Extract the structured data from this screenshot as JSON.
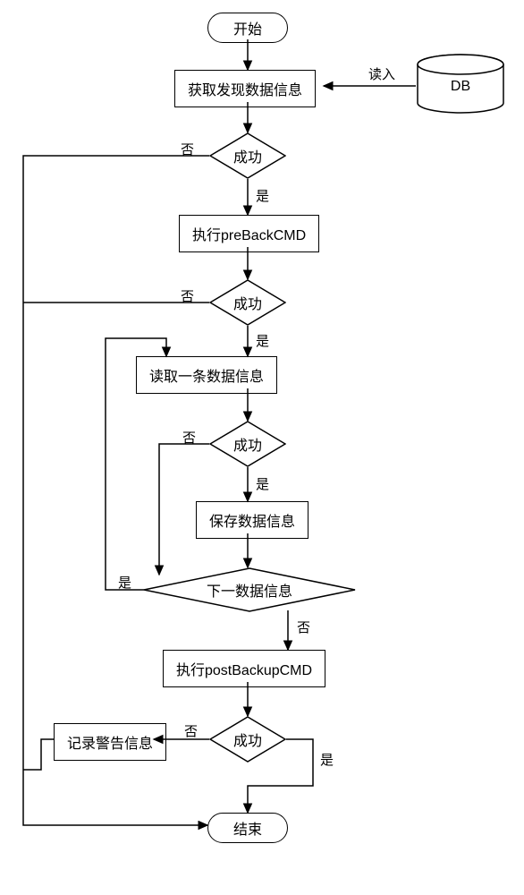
{
  "chart_data": {
    "type": "flowchart",
    "title": "",
    "nodes": [
      {
        "id": "start",
        "type": "terminal",
        "label": "开始"
      },
      {
        "id": "fetch",
        "type": "process",
        "label": "获取发现数据信息"
      },
      {
        "id": "db",
        "type": "database",
        "label": "DB"
      },
      {
        "id": "succ1",
        "type": "decision",
        "label": "成功"
      },
      {
        "id": "preback",
        "type": "process",
        "label": "执行preBackCMD"
      },
      {
        "id": "succ2",
        "type": "decision",
        "label": "成功"
      },
      {
        "id": "readone",
        "type": "process",
        "label": "读取一条数据信息"
      },
      {
        "id": "succ3",
        "type": "decision",
        "label": "成功"
      },
      {
        "id": "save",
        "type": "process",
        "label": "保存数据信息"
      },
      {
        "id": "next",
        "type": "decision",
        "label": "下一数据信息"
      },
      {
        "id": "postback",
        "type": "process",
        "label": "执行postBackupCMD"
      },
      {
        "id": "succ4",
        "type": "decision",
        "label": "成功"
      },
      {
        "id": "warn",
        "type": "process",
        "label": "记录警告信息"
      },
      {
        "id": "end",
        "type": "terminal",
        "label": "结束"
      }
    ],
    "edges": [
      {
        "from": "start",
        "to": "fetch",
        "label": ""
      },
      {
        "from": "db",
        "to": "fetch",
        "label": "读入"
      },
      {
        "from": "fetch",
        "to": "succ1",
        "label": ""
      },
      {
        "from": "succ1",
        "to": "preback",
        "label": "是"
      },
      {
        "from": "succ1",
        "to": "end",
        "label": "否",
        "path": "left-bus"
      },
      {
        "from": "preback",
        "to": "succ2",
        "label": ""
      },
      {
        "from": "succ2",
        "to": "readone",
        "label": "是"
      },
      {
        "from": "succ2",
        "to": "end",
        "label": "否",
        "path": "left-bus"
      },
      {
        "from": "readone",
        "to": "succ3",
        "label": ""
      },
      {
        "from": "succ3",
        "to": "save",
        "label": "是"
      },
      {
        "from": "succ3",
        "to": "next",
        "label": "否",
        "path": "inner-left"
      },
      {
        "from": "save",
        "to": "next",
        "label": ""
      },
      {
        "from": "next",
        "to": "readone",
        "label": "是",
        "path": "inner-right-up"
      },
      {
        "from": "next",
        "to": "postback",
        "label": "否"
      },
      {
        "from": "postback",
        "to": "succ4",
        "label": ""
      },
      {
        "from": "succ4",
        "to": "warn",
        "label": "否"
      },
      {
        "from": "succ4",
        "to": "end",
        "label": "是"
      },
      {
        "from": "warn",
        "to": "end",
        "label": "",
        "path": "left-bus"
      }
    ]
  },
  "labels": {
    "start": "开始",
    "fetch": "获取发现数据信息",
    "db": "DB",
    "read_in": "读入",
    "success": "成功",
    "yes": "是",
    "no": "否",
    "preback": "执行preBackCMD",
    "readone": "读取一条数据信息",
    "save": "保存数据信息",
    "next": "下一数据信息",
    "postback": "执行postBackupCMD",
    "warn": "记录警告信息",
    "end": "结束"
  }
}
